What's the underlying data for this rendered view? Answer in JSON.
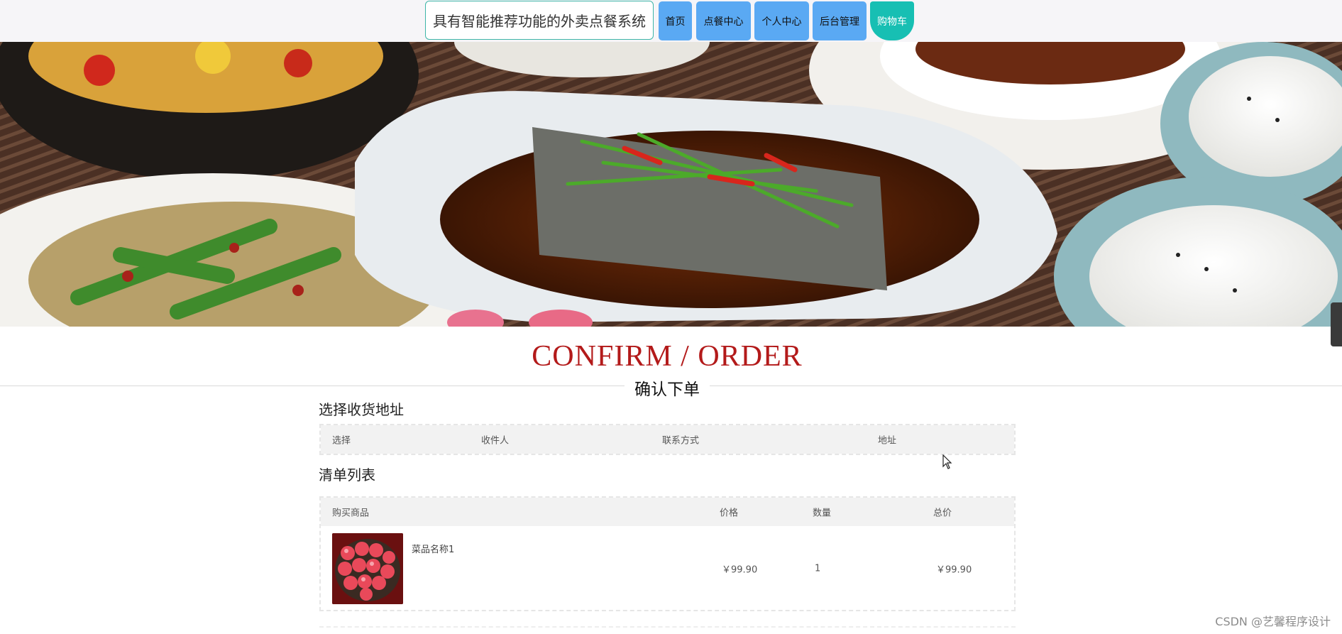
{
  "header": {
    "site_title": "具有智能推荐功能的外卖点餐系统",
    "nav": [
      {
        "label": "首页"
      },
      {
        "label": "点餐中心"
      },
      {
        "label": "个人中心"
      },
      {
        "label": "后台管理"
      },
      {
        "label": "购物车"
      }
    ]
  },
  "heading": {
    "en": "CONFIRM / ORDER",
    "cn": "确认下单"
  },
  "address_section": {
    "title": "选择收货地址",
    "columns": [
      "选择",
      "收件人",
      "联系方式",
      "地址"
    ]
  },
  "order_section": {
    "title": "清单列表",
    "columns": [
      "购买商品",
      "价格",
      "数量",
      "总价"
    ],
    "items": [
      {
        "name": "菜品名称1",
        "price": "￥99.90",
        "quantity": "1",
        "total": "￥99.90"
      }
    ]
  },
  "watermark": "CSDN @艺馨程序设计",
  "colors": {
    "nav_button": "#5aa9f3",
    "nav_active": "#17bfb3",
    "heading_red": "#b31a1a"
  }
}
